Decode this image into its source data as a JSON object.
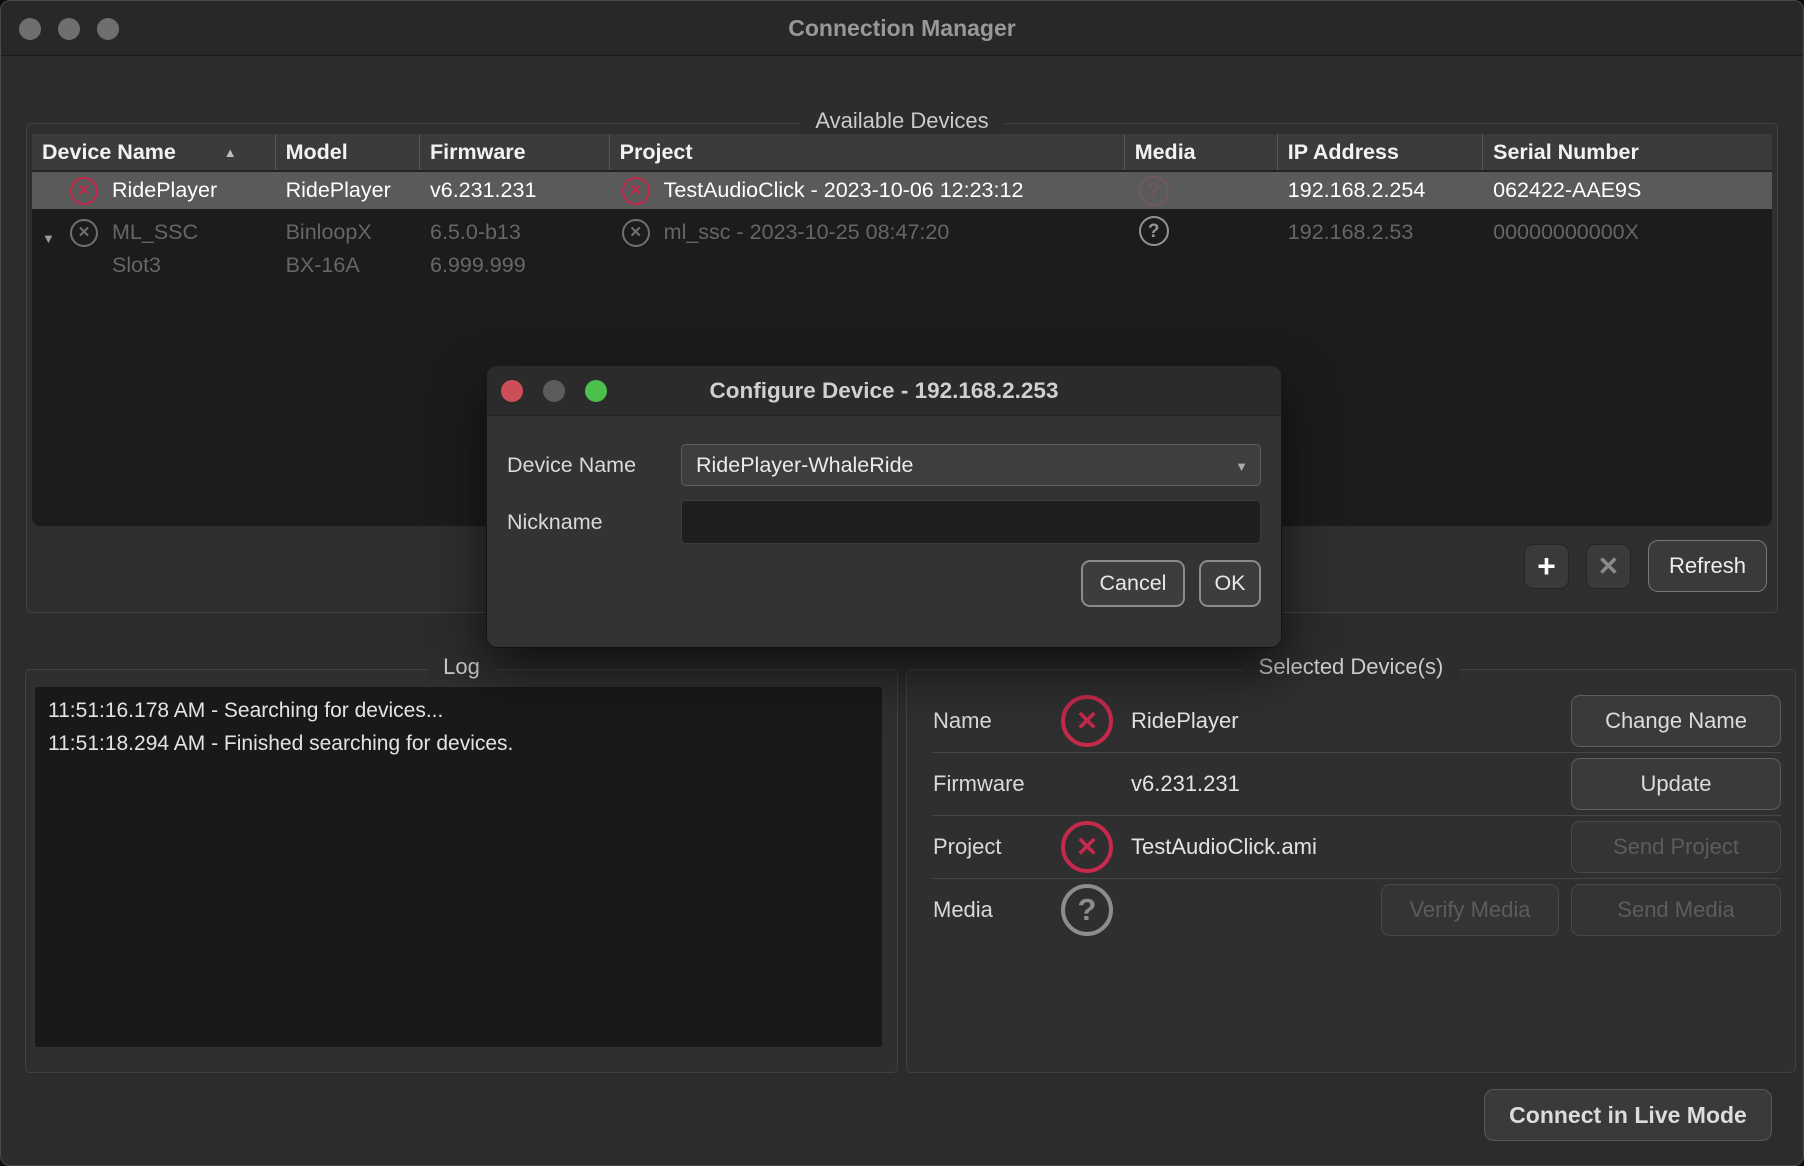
{
  "window": {
    "title": "Connection Manager"
  },
  "icons": {
    "error": "✕",
    "unknown": "?",
    "sort_ascending": "▲",
    "expand": "▼",
    "dropdown_arrow": "▼",
    "add": "+",
    "remove": "✕"
  },
  "colors": {
    "error_red": "#c5294b",
    "selected_row": "#5a5a5a",
    "dialog_green_dot": "#4dbf4d",
    "dialog_red_dot": "#ce4e57"
  },
  "devices_section": {
    "legend": "Available Devices",
    "table": {
      "columns": [
        {
          "label": "Device Name"
        },
        {
          "label": "Model"
        },
        {
          "label": "Firmware"
        },
        {
          "label": "Project"
        },
        {
          "label": "Media"
        },
        {
          "label": "IP Address"
        },
        {
          "label": "Serial Number"
        }
      ],
      "rows": [
        {
          "selected": true,
          "device_name": {
            "text": "RidePlayer"
          },
          "model": "RidePlayer",
          "firmware": "v6.231.231",
          "project": {
            "text": "TestAudioClick - 2023-10-06 12:23:12"
          },
          "ip": "192.168.2.254",
          "serial": "062422-AAE9S"
        },
        {
          "expandable": true,
          "device_name": {
            "text": "ML_SSC",
            "subtext": "Slot3"
          },
          "model": "BinloopX",
          "model_sub": "BX-16A",
          "firmware": "6.5.0-b13",
          "firmware_sub": "6.999.999",
          "project": {
            "text": "ml_ssc - 2023-10-25 08:47:20"
          },
          "ip": "192.168.2.53",
          "serial": "00000000000X"
        }
      ]
    },
    "actions": {
      "refresh": "Refresh"
    }
  },
  "dialog": {
    "title": "Configure Device - 192.168.2.253",
    "device_name_label": "Device Name",
    "device_name_value": "RidePlayer-WhaleRide",
    "nickname_label": "Nickname",
    "nickname_value": "",
    "cancel_label": "Cancel",
    "ok_label": "OK"
  },
  "log_section": {
    "legend": "Log",
    "entries": [
      "11:51:16.178 AM - Searching for devices...",
      "11:51:18.294 AM - Finished searching for devices."
    ]
  },
  "selected_section": {
    "legend": "Selected Device(s)",
    "rows": {
      "name": {
        "label": "Name",
        "value": "RidePlayer"
      },
      "firmware": {
        "label": "Firmware",
        "value": "v6.231.231"
      },
      "project": {
        "label": "Project",
        "value": "TestAudioClick.ami"
      },
      "media": {
        "label": "Media"
      }
    },
    "buttons": {
      "change_name": "Change Name",
      "update": "Update",
      "send_project": "Send Project",
      "verify_media": "Verify Media",
      "send_media": "Send Media"
    }
  },
  "footer": {
    "connect_live_label": "Connect in Live Mode"
  }
}
